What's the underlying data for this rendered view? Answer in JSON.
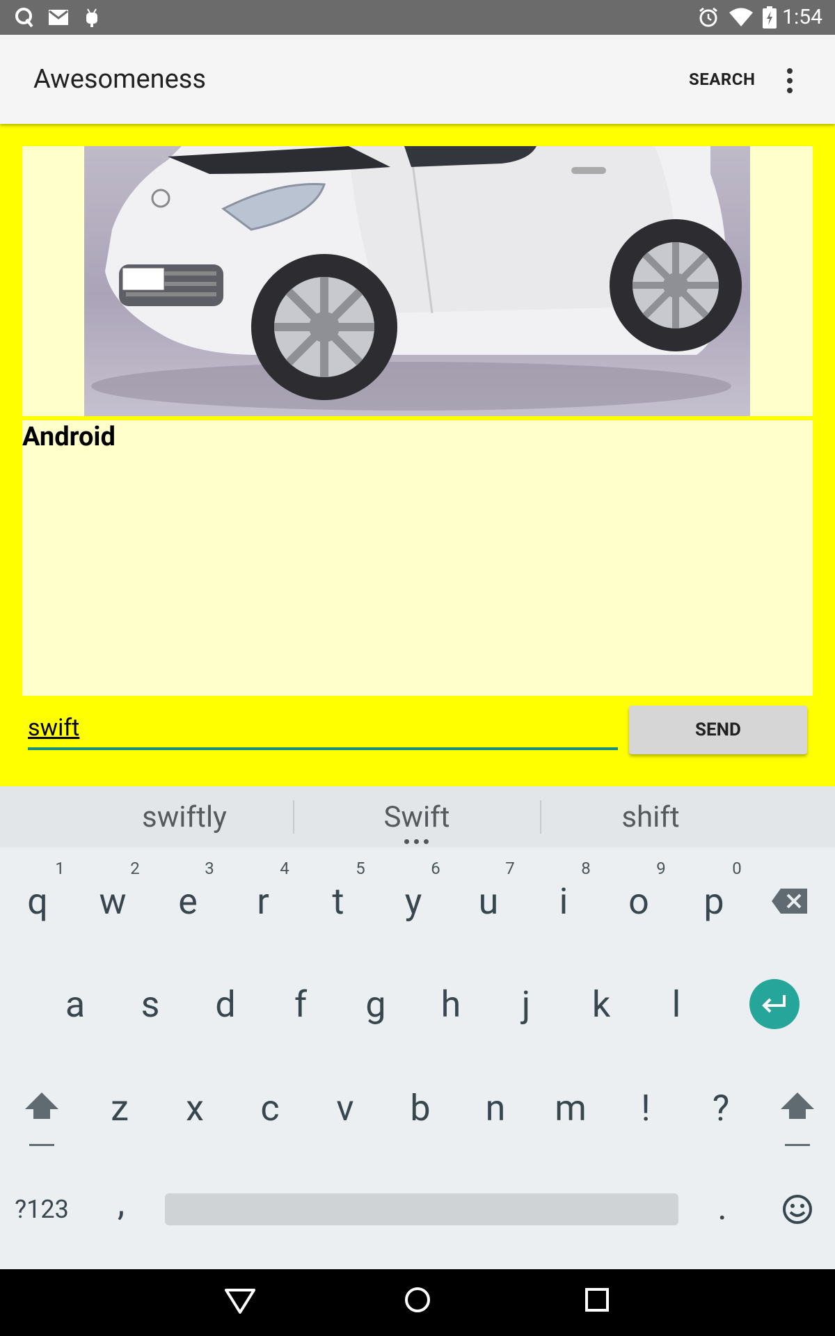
{
  "status_bar": {
    "time": "1:54",
    "left_icons": [
      "q-app-icon",
      "gmail-icon",
      "android-debug-icon"
    ],
    "right_icons": [
      "alarm-icon",
      "wifi-icon",
      "battery-icon"
    ]
  },
  "app_bar": {
    "title": "Awesomeness",
    "search_label": "SEARCH",
    "overflow_icon": "more-vert-icon"
  },
  "content": {
    "background": "#ffff00",
    "card_background": "#ffffcc",
    "image": "white-compact-car-image",
    "message": "Android"
  },
  "compose": {
    "input_value": "swift",
    "send_label": "SEND",
    "accent": "#13907f"
  },
  "keyboard": {
    "suggestions": [
      "swiftly",
      "Swift",
      "shift"
    ],
    "row1": [
      "q",
      "w",
      "e",
      "r",
      "t",
      "y",
      "u",
      "i",
      "o",
      "p"
    ],
    "row1_hints": [
      "1",
      "2",
      "3",
      "4",
      "5",
      "6",
      "7",
      "8",
      "9",
      "0"
    ],
    "row2": [
      "a",
      "s",
      "d",
      "f",
      "g",
      "h",
      "j",
      "k",
      "l"
    ],
    "row3": [
      "z",
      "x",
      "c",
      "v",
      "b",
      "n",
      "m",
      "!",
      "?"
    ],
    "symbols_label": "?123",
    "comma": ",",
    "period": ".",
    "enter_color": "#26a69a"
  },
  "nav_bar": {
    "icons": [
      "back-icon",
      "home-icon",
      "recents-icon"
    ]
  }
}
